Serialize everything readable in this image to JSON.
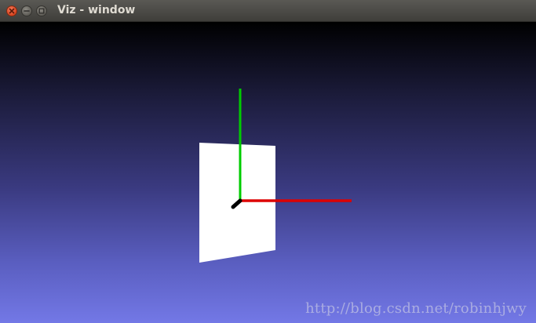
{
  "window": {
    "title": "Viz - window",
    "buttons": {
      "close_icon": "close-icon",
      "minimize_icon": "minimize-icon",
      "maximize_icon": "maximize-icon"
    }
  },
  "viewport": {
    "background_colors": {
      "top": "#000000",
      "bottom": "#7378e6"
    },
    "axes": {
      "x_color": "#dd0000",
      "y_color": "#00cc00",
      "z_color": "#000000"
    },
    "plane_color": "#ffffff",
    "watermark": "http://blog.csdn.net/robinhjwy"
  }
}
